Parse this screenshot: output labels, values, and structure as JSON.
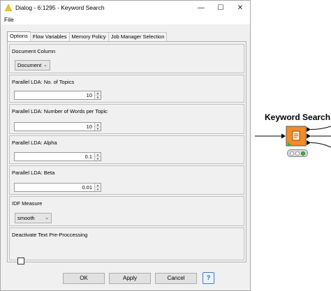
{
  "window": {
    "title": "Dialog - 6:1295 - Keyword Search",
    "minimize": "—",
    "maximize": "☐",
    "close": "✕"
  },
  "menu": {
    "file": "File"
  },
  "tabs": [
    "Options",
    "Flow Variables",
    "Memory Policy",
    "Job Manager Selection"
  ],
  "options": {
    "document_column": {
      "label": "Document Column",
      "value": "Document"
    },
    "num_topics": {
      "label": "Parallel LDA: No. of Topics",
      "value": "10"
    },
    "words_per_topic": {
      "label": "Parallel LDA: Number of Words per Topic",
      "value": "10"
    },
    "alpha": {
      "label": "Parallel LDA: Alpha",
      "value": "0.1"
    },
    "beta": {
      "label": "Parallel LDA: Beta",
      "value": "0.01"
    },
    "idf_measure": {
      "label": "IDF Measure",
      "value": "smooth"
    },
    "deactivate_preprocessing": {
      "label": "Deactivate Text Pre-Proccessing",
      "checked": false
    }
  },
  "buttons": {
    "ok": "OK",
    "apply": "Apply",
    "cancel": "Cancel",
    "help": "?"
  },
  "node": {
    "title": "Keyword Search",
    "icon": "document-icon",
    "color": "#f28c28",
    "status_lights": [
      "#ffffff",
      "#ffffff",
      "#3cb043"
    ]
  }
}
